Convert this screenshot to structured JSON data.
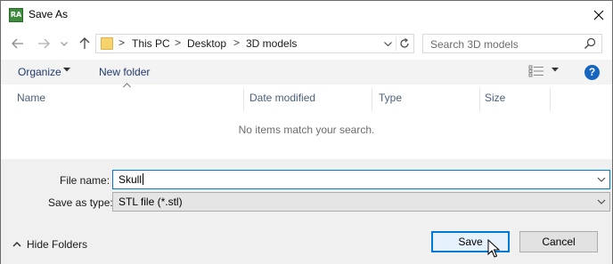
{
  "window": {
    "title": "Save As",
    "icon_label": "RA"
  },
  "navigation": {
    "back_icon": "arrow-left-icon",
    "forward_icon": "arrow-right-icon",
    "recent_icon": "chevron-down-icon",
    "up_icon": "arrow-up-icon"
  },
  "address": {
    "crumbs": [
      "This PC",
      "Desktop",
      "3D models"
    ],
    "separator": ">"
  },
  "search": {
    "placeholder": "Search 3D models"
  },
  "toolbar": {
    "organize_label": "Organize",
    "new_folder_label": "New folder",
    "help_label": "?"
  },
  "file_list": {
    "columns": [
      "Name",
      "Date modified",
      "Type",
      "Size"
    ],
    "empty_message": "No items match your search."
  },
  "form": {
    "file_name_label": "File name:",
    "file_name_value": "Skull",
    "save_type_label": "Save as type:",
    "save_type_value": "STL file (*.stl)"
  },
  "footer": {
    "hide_folders_label": "Hide Folders",
    "save_label": "Save",
    "cancel_label": "Cancel"
  },
  "colors": {
    "accent": "#0078d7",
    "link_text": "#1f3a6b",
    "help_icon": "#1565c0",
    "folder": "#f7d36b"
  }
}
